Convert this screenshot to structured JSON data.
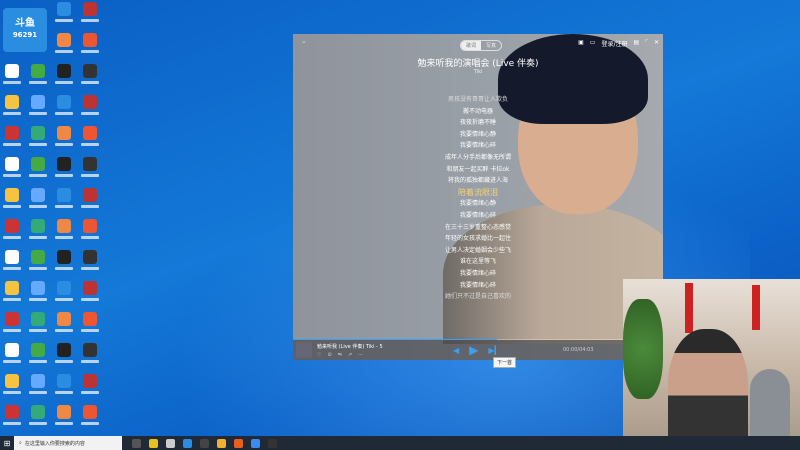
{
  "desktop": {
    "badge_number": "96291",
    "logo_text": "斗鱼"
  },
  "player": {
    "tabs": [
      "歌词",
      "写真"
    ],
    "window_controls": [
      "skin-icon",
      "message-icon",
      "登录/注册",
      "mini-icon",
      "maximize-icon",
      "close-icon"
    ],
    "login_label": "登录/注册",
    "title": "勉来听我的演唱会 (Live 伴奏)",
    "artist": "Tiki",
    "lyrics": [
      "男孩没有哥哥让人欺负",
      "搬不动电器",
      "夜夜折磨不睡",
      "我要情绪心静",
      "我要情绪心碎",
      "成年人分手后都像无所谓",
      "和朋友一起买醉 卡拉ok",
      "将我的孤独都藏进人海",
      "陪着流眼泪",
      "我要情绪心静",
      "我要情绪心碎",
      "在三十三岁重整心态感觉",
      "年轻的女孩求婚比一起住",
      "让男人决定婚姻会少些飞",
      "谁在这里等飞",
      "我要情绪心碎",
      "我要情绪心碎",
      "她们只不过是自己喜欢的"
    ],
    "current_index": 8,
    "progress": 0.55,
    "now_playing": "勉来听我 (Live 伴奏)",
    "now_artist": "Tiki - 5",
    "time": "00:00/04:03",
    "tooltip": "下一首"
  },
  "taskbar": {
    "search_placeholder": "在这里输入你要搜索的内容"
  }
}
